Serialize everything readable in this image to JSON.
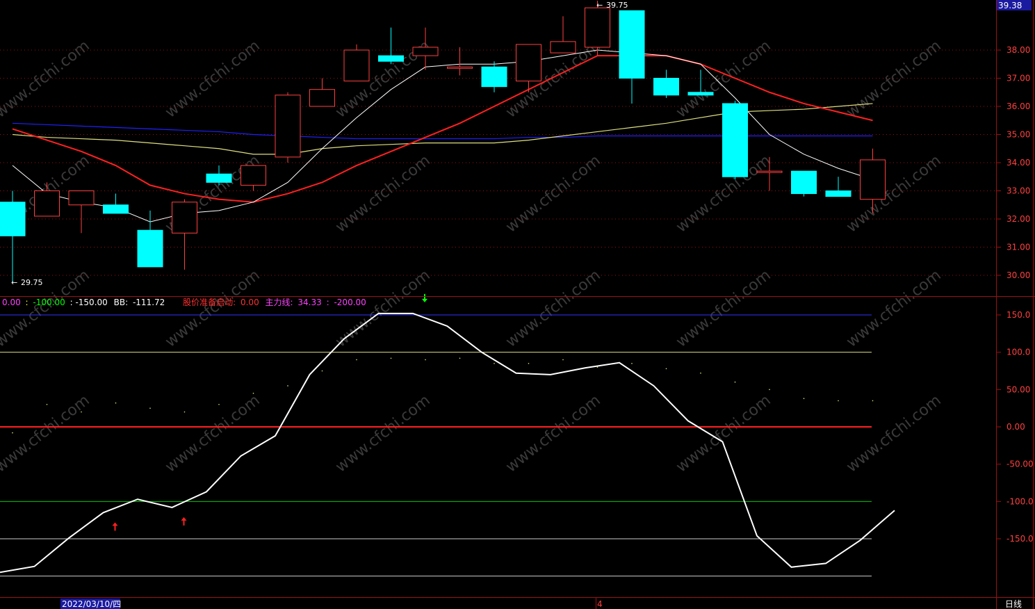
{
  "colors": {
    "background": "#000000",
    "up_candle": "#ff4040",
    "down_candle": "#00ffff",
    "ma5": "#ffffff",
    "ma10": "#ff2020",
    "ma20": "#e0e080",
    "ma60": "#2020ff",
    "indicator": "#ffffff",
    "line_150": "#3030ff",
    "line_100": "#e0e080",
    "line_0": "#ff2020",
    "line_m100": "#00cc00",
    "line_other": "#cccccc",
    "axis": "#a01010",
    "grid": "#a01010"
  },
  "price_axis": {
    "current_price": "39.38",
    "ticks": [
      "38.00",
      "37.00",
      "36.00",
      "35.00",
      "34.00",
      "33.00",
      "32.00",
      "31.00",
      "30.00"
    ],
    "tick_values": [
      38,
      37,
      36,
      35,
      34,
      33,
      32,
      31,
      30
    ]
  },
  "price_annotations": {
    "high": "39.75",
    "low": "29.75"
  },
  "indicator_header": {
    "v1": "0.00",
    "sep": ":",
    "v2": "-100.00",
    "v3": "-150.00",
    "bb_label": "BB:",
    "bb_value": "-111.72",
    "ready_label": "股价准备启动:",
    "ready_value": "0.00",
    "main_label": "主力线:",
    "main_value": "34.33",
    "v4": "-200.00"
  },
  "indicator_axis": {
    "ticks": [
      "150.0",
      "100.0",
      "50.00",
      "0.00",
      "-50.00",
      "-100.0",
      "-150.0"
    ],
    "tick_values": [
      150,
      100,
      50,
      0,
      -50,
      -100,
      -150
    ]
  },
  "x_axis": {
    "date_label": "2022/03/10/四",
    "month_marker": "4",
    "period": "日线"
  },
  "watermark": "www.cfchi.com",
  "chart_data": {
    "type": "candlestick",
    "candles": [
      {
        "o": 32.6,
        "h": 33.0,
        "l": 29.75,
        "c": 31.4
      },
      {
        "o": 32.1,
        "h": 33.3,
        "l": 32.1,
        "c": 33.0
      },
      {
        "o": 32.5,
        "h": 33.0,
        "l": 31.5,
        "c": 33.0
      },
      {
        "o": 32.5,
        "h": 32.9,
        "l": 32.2,
        "c": 32.2
      },
      {
        "o": 31.6,
        "h": 32.3,
        "l": 30.3,
        "c": 30.3
      },
      {
        "o": 31.5,
        "h": 32.7,
        "l": 30.2,
        "c": 32.6
      },
      {
        "o": 33.6,
        "h": 33.9,
        "l": 33.2,
        "c": 33.3
      },
      {
        "o": 33.2,
        "h": 33.9,
        "l": 33.0,
        "c": 33.9
      },
      {
        "o": 34.2,
        "h": 36.5,
        "l": 34.0,
        "c": 36.4
      },
      {
        "o": 36.0,
        "h": 37.0,
        "l": 36.0,
        "c": 36.6
      },
      {
        "o": 36.9,
        "h": 38.2,
        "l": 36.9,
        "c": 38.0
      },
      {
        "o": 37.8,
        "h": 38.8,
        "l": 37.5,
        "c": 37.6
      },
      {
        "o": 37.8,
        "h": 38.8,
        "l": 37.3,
        "c": 38.1
      },
      {
        "o": 37.4,
        "h": 38.1,
        "l": 37.1,
        "c": 37.4
      },
      {
        "o": 37.4,
        "h": 37.6,
        "l": 36.5,
        "c": 36.7
      },
      {
        "o": 36.9,
        "h": 38.2,
        "l": 36.5,
        "c": 38.2
      },
      {
        "o": 37.9,
        "h": 39.2,
        "l": 37.9,
        "c": 38.3
      },
      {
        "o": 38.1,
        "h": 39.75,
        "l": 37.8,
        "c": 39.5
      },
      {
        "o": 39.4,
        "h": 39.4,
        "l": 36.1,
        "c": 37.0
      },
      {
        "o": 37.0,
        "h": 37.3,
        "l": 36.3,
        "c": 36.4
      },
      {
        "o": 36.5,
        "h": 37.3,
        "l": 36.4,
        "c": 36.4
      },
      {
        "o": 36.1,
        "h": 36.2,
        "l": 33.4,
        "c": 33.5
      },
      {
        "o": 33.7,
        "h": 34.2,
        "l": 33.0,
        "c": 33.7
      },
      {
        "o": 33.7,
        "h": 33.7,
        "l": 32.8,
        "c": 32.9
      },
      {
        "o": 33.0,
        "h": 33.5,
        "l": 32.8,
        "c": 32.8
      },
      {
        "o": 32.7,
        "h": 34.5,
        "l": 32.2,
        "c": 34.1
      }
    ],
    "ma5": [
      33.9,
      32.9,
      32.6,
      32.4,
      31.9,
      32.2,
      32.3,
      32.6,
      33.3,
      34.5,
      35.6,
      36.6,
      37.4,
      37.5,
      37.5,
      37.6,
      37.8,
      38.0,
      37.9,
      37.8,
      37.5,
      36.3,
      35.0,
      34.3,
      33.8,
      33.4
    ],
    "ma10": [
      35.2,
      34.8,
      34.4,
      33.9,
      33.2,
      32.9,
      32.7,
      32.6,
      32.9,
      33.3,
      33.9,
      34.4,
      34.9,
      35.4,
      36.0,
      36.6,
      37.2,
      37.8,
      37.8,
      37.8,
      37.5,
      37.0,
      36.5,
      36.1,
      35.8,
      35.5
    ],
    "ma20": [
      35.0,
      34.9,
      34.85,
      34.8,
      34.7,
      34.6,
      34.5,
      34.3,
      34.3,
      34.5,
      34.6,
      34.65,
      34.7,
      34.7,
      34.7,
      34.8,
      34.95,
      35.1,
      35.25,
      35.4,
      35.6,
      35.8,
      35.85,
      35.9,
      36.0,
      36.1
    ],
    "ma60": [
      35.4,
      35.35,
      35.3,
      35.25,
      35.2,
      35.15,
      35.1,
      35.0,
      34.95,
      34.9,
      34.85,
      34.85,
      34.85,
      34.85,
      34.85,
      34.9,
      34.9,
      34.95,
      34.95,
      34.95,
      34.95,
      34.95,
      34.95,
      34.95,
      34.95,
      34.95
    ],
    "indicator_line": [
      -195,
      -187,
      -149,
      -115,
      -97,
      -108,
      -87,
      -39,
      -12,
      70,
      118,
      152,
      152,
      135,
      100,
      72,
      70,
      79,
      86,
      55,
      8,
      -20,
      -146,
      -188,
      -183,
      -152,
      -112
    ],
    "indicator_dots": [
      -8,
      30,
      20,
      32,
      25,
      20,
      30,
      45,
      55,
      75,
      90,
      92,
      90,
      92,
      85,
      85,
      90,
      80,
      85,
      78,
      72,
      60,
      50,
      38,
      35,
      35
    ],
    "buy_signals": [
      3,
      5
    ],
    "sell_signals": [
      12
    ],
    "hlines": [
      150,
      100,
      0,
      -100,
      -150,
      -200
    ]
  }
}
